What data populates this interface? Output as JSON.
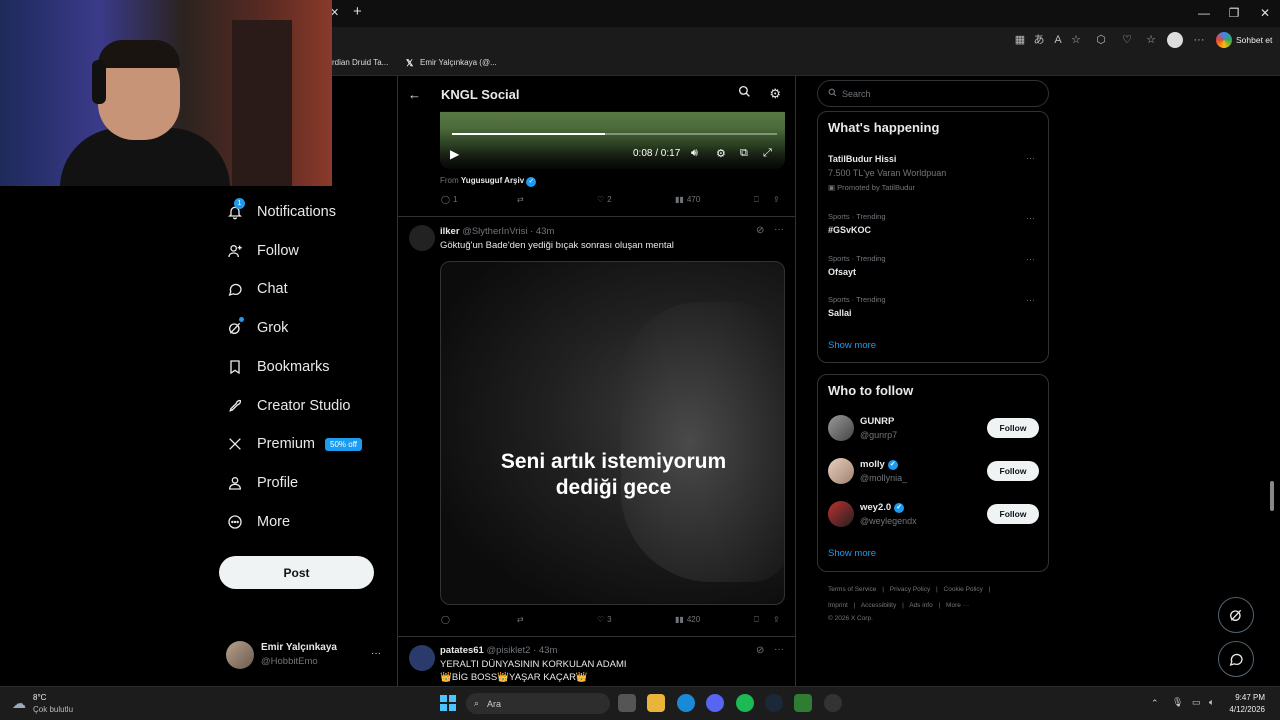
{
  "browser": {
    "tab_close": "✕",
    "new_tab": "+",
    "bookmarks": [
      "rdian Druid Ta...",
      "Emir Yalçınkaya (@..."
    ],
    "profile_label": "Sohbet et",
    "window_min": "—",
    "window_max": "❐",
    "window_close": "✕"
  },
  "nav": {
    "items": [
      {
        "label": "Notifications",
        "icon": "bell-icon",
        "badge": "1"
      },
      {
        "label": "Follow",
        "icon": "person-plus-icon"
      },
      {
        "label": "Chat",
        "icon": "chat-bubble-icon"
      },
      {
        "label": "Grok",
        "icon": "grok-icon"
      },
      {
        "label": "Bookmarks",
        "icon": "bookmark-icon"
      },
      {
        "label": "Creator Studio",
        "icon": "rocket-icon"
      },
      {
        "label": "Premium",
        "icon": "x-logo-icon",
        "badge": "50% off"
      },
      {
        "label": "Profile",
        "icon": "person-icon"
      },
      {
        "label": "More",
        "icon": "more-circle-icon"
      }
    ],
    "post_label": "Post",
    "account": {
      "name": "Emir Yalçınkaya",
      "handle": "@HobbitEmo",
      "more": "···"
    }
  },
  "header": {
    "title": "KNGL Social"
  },
  "video_top": {
    "time": "0:08 / 0:17",
    "progress": 0.47,
    "from_label": "From",
    "from_name": "Yugusuguf Arşiv"
  },
  "tweet1_actions": {
    "replies": "1",
    "retweets": "",
    "likes": "2",
    "views": "470"
  },
  "tweet2": {
    "name": "ilker",
    "handle": "@SlytherInVrisi",
    "time": "· 43m",
    "text": "Göktuğ'un Bade'den yediği bıçak sonrası oluşan mental",
    "overlay": "Seni artık istemiyorum\ndediği gece",
    "replies": "",
    "retweets": "",
    "likes": "3",
    "views": "420"
  },
  "tweet3": {
    "name": "patates61",
    "handle": "@pisiklet2",
    "time": "· 43m",
    "line1": "YERALTI DÜNYASININ KORKULAN ADAMI",
    "line2": "👑BİG BOSS👑YAŞAR KAÇAR👑"
  },
  "right": {
    "search_placeholder": "Search",
    "happening_title": "What's happening",
    "trends": [
      {
        "category": "",
        "name": "TatilBudur Hissi",
        "sub": "7.500 TL'ye Varan Worldpuan",
        "promo": "Promoted by TatilBudur"
      },
      {
        "category": "Sports · Trending",
        "name": "#GSvKOC"
      },
      {
        "category": "Sports · Trending",
        "name": "Ofsayt"
      },
      {
        "category": "Sports · Trending",
        "name": "Sallai"
      }
    ],
    "show_more": "Show more",
    "wtf_title": "Who to follow",
    "wtf": [
      {
        "name": "GUNRP",
        "handle": "@gunrp7",
        "verified": false
      },
      {
        "name": "molly",
        "handle": "@mollynia_",
        "verified": true
      },
      {
        "name": "wey2.0",
        "handle": "@weylegendx",
        "verified": true
      }
    ],
    "follow_label": "Follow",
    "footer1": [
      "Terms of Service",
      "|",
      "Privacy Policy",
      "|",
      "Cookie Policy",
      "|"
    ],
    "footer2": [
      "Imprint",
      "|",
      "Accessibility",
      "|",
      "Ads info",
      "|",
      "More ···"
    ],
    "footer3": "© 2026 X Corp."
  },
  "taskbar": {
    "temp": "8°C",
    "weather": "Çok bulutlu",
    "search": "Ara",
    "time": "9:47 PM",
    "date": "4/12/2026"
  }
}
